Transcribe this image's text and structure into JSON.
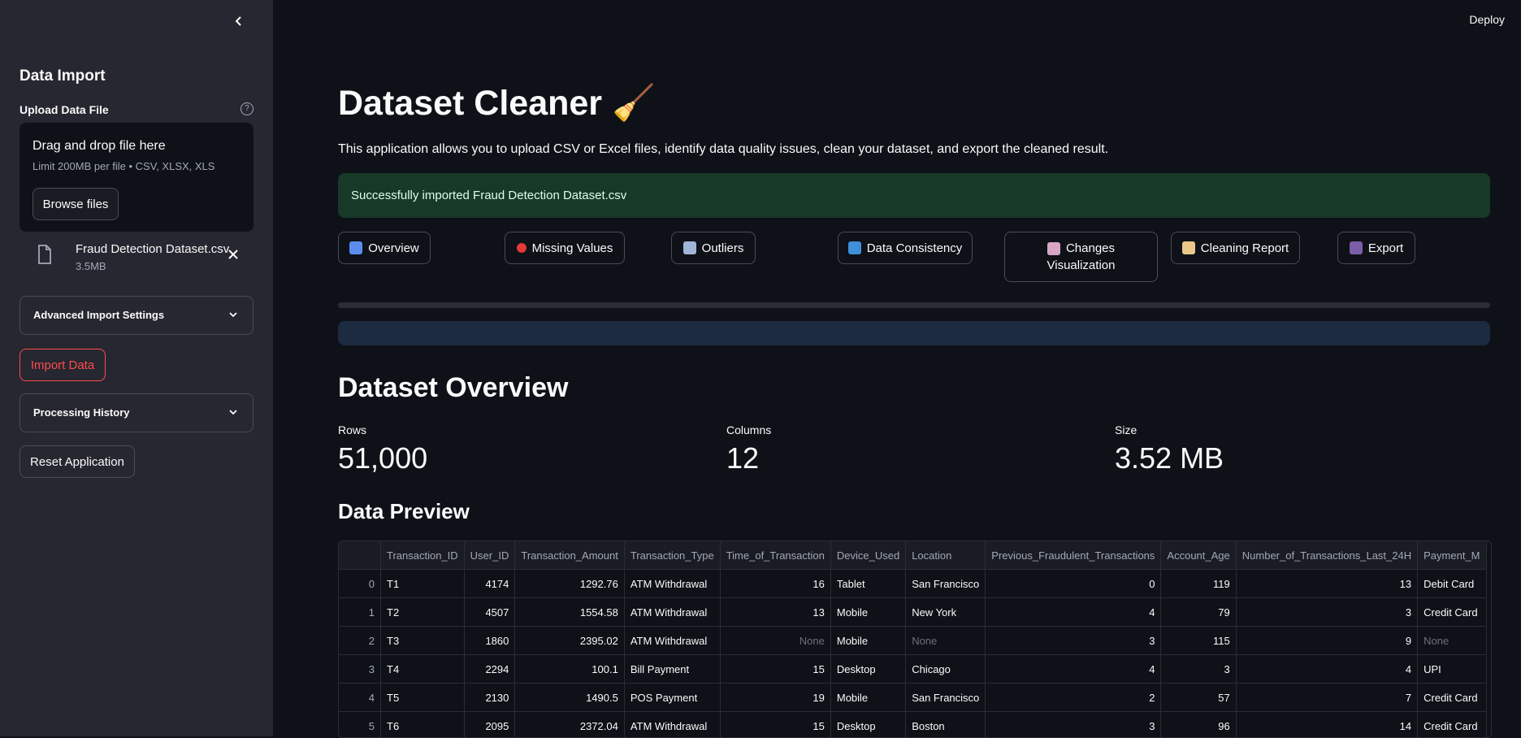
{
  "sidebar": {
    "title": "Data Import",
    "upload_label": "Upload Data File",
    "dropzone_title": "Drag and drop file here",
    "dropzone_limit": "Limit 200MB per file • CSV, XLSX, XLS",
    "browse_label": "Browse files",
    "file_name": "Fraud Detection Dataset.csv",
    "file_size": "3.5MB",
    "advanced_label": "Advanced Import Settings",
    "import_label": "Import Data",
    "history_label": "Processing History",
    "reset_label": "Reset Application"
  },
  "header": {
    "deploy_label": "Deploy"
  },
  "main": {
    "title": "Dataset Cleaner",
    "title_emoji": "🧹",
    "description": "This application allows you to upload CSV or Excel files, identify data quality issues, clean your dataset, and export the cleaned result.",
    "success_message": "Successfully imported Fraud Detection Dataset.csv",
    "tabs": [
      {
        "label": "Overview",
        "icon": "bar-chart-icon",
        "color": "#5b8def"
      },
      {
        "label": "Missing Values",
        "icon": "question-icon",
        "color": "#e53935"
      },
      {
        "label": "Outliers",
        "icon": "line-chart-icon",
        "color": "#9fb4d8"
      },
      {
        "label": "Data Consistency",
        "icon": "refresh-icon",
        "color": "#3f8fd9"
      },
      {
        "label": "Changes",
        "label2": "Visualization",
        "icon": "chart-down-icon",
        "color": "#d7a6c5"
      },
      {
        "label": "Cleaning Report",
        "icon": "memo-icon",
        "color": "#e9c88a"
      },
      {
        "label": "Export",
        "icon": "floppy-icon",
        "color": "#7b5ea7"
      }
    ],
    "overview_heading": "Dataset Overview",
    "metrics": [
      {
        "label": "Rows",
        "value": "51,000"
      },
      {
        "label": "Columns",
        "value": "12"
      },
      {
        "label": "Size",
        "value": "3.52 MB"
      }
    ],
    "preview_heading": "Data Preview",
    "table": {
      "columns": [
        "",
        "Transaction_ID",
        "User_ID",
        "Transaction_Amount",
        "Transaction_Type",
        "Time_of_Transaction",
        "Device_Used",
        "Location",
        "Previous_Fraudulent_Transactions",
        "Account_Age",
        "Number_of_Transactions_Last_24H",
        "Payment_M"
      ],
      "rows": [
        [
          "0",
          "T1",
          "4174",
          "1292.76",
          "ATM Withdrawal",
          "16",
          "Tablet",
          "San Francisco",
          "0",
          "119",
          "13",
          "Debit Card"
        ],
        [
          "1",
          "T2",
          "4507",
          "1554.58",
          "ATM Withdrawal",
          "13",
          "Mobile",
          "New York",
          "4",
          "79",
          "3",
          "Credit Card"
        ],
        [
          "2",
          "T3",
          "1860",
          "2395.02",
          "ATM Withdrawal",
          "None",
          "Mobile",
          "None",
          "3",
          "115",
          "9",
          "None"
        ],
        [
          "3",
          "T4",
          "2294",
          "100.1",
          "Bill Payment",
          "15",
          "Desktop",
          "Chicago",
          "4",
          "3",
          "4",
          "UPI"
        ],
        [
          "4",
          "T5",
          "2130",
          "1490.5",
          "POS Payment",
          "19",
          "Mobile",
          "San Francisco",
          "2",
          "57",
          "7",
          "Credit Card"
        ],
        [
          "5",
          "T6",
          "2095",
          "2372.04",
          "ATM Withdrawal",
          "15",
          "Desktop",
          "Boston",
          "3",
          "96",
          "14",
          "Credit Card"
        ]
      ]
    }
  }
}
